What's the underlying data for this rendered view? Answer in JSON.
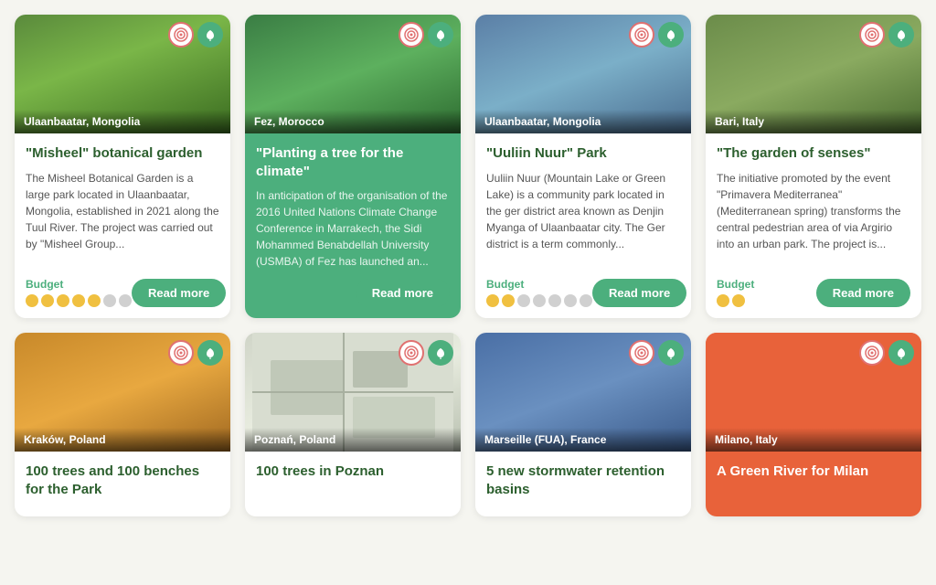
{
  "cards": [
    {
      "id": "misheel",
      "location": "Ulaanbaatar, Mongolia",
      "title": "\"Misheel\" botanical garden",
      "desc": "The Misheel Botanical Garden is a large park located in Ulaanbaatar, Mongolia, established in 2021 along the Tuul River. The project was carried out by \"Misheel Group...",
      "budget_label": "Budget",
      "budget_dots": [
        true,
        true,
        true,
        true,
        true,
        false,
        false
      ],
      "read_more": "Read more",
      "highlighted": false,
      "image_class": "forest"
    },
    {
      "id": "planting",
      "location": "Fez, Morocco",
      "title": "\"Planting a tree for the climate\"",
      "desc": "In anticipation of the organisation of the 2016 United Nations Climate Change Conference in Marrakech, the Sidi Mohammed Benabdellah University (USMBA) of Fez has launched an...",
      "budget_label": null,
      "budget_dots": [],
      "read_more": "Read more",
      "highlighted": true,
      "image_class": "trees-green"
    },
    {
      "id": "uuliin",
      "location": "Ulaanbaatar, Mongolia",
      "title": "\"Uuliin Nuur\" Park",
      "desc": "Uuliin Nuur (Mountain Lake or Green Lake) is a community park located in the ger district area known as Denjin Myanga of Ulaanbaatar city. The Ger district is a term commonly...",
      "budget_label": "Budget",
      "budget_dots": [
        true,
        true,
        false,
        false,
        false,
        false,
        false
      ],
      "read_more": "Read more",
      "highlighted": false,
      "image_class": "river"
    },
    {
      "id": "garden-senses",
      "location": "Bari, Italy",
      "title": "\"The garden of senses\"",
      "desc": "The initiative promoted by the event \"Primavera Mediterranea\" (Mediterranean spring) transforms the central pedestrian area of via Argirio into an urban park. The project is...",
      "budget_label": "Budget",
      "budget_dots": [
        true,
        true
      ],
      "read_more": "Read more",
      "highlighted": false,
      "image_class": "construction"
    },
    {
      "id": "100trees",
      "location": "Kraków, Poland",
      "title": "100 trees and 100 benches for the Park",
      "desc": "",
      "budget_label": null,
      "budget_dots": [],
      "read_more": null,
      "highlighted": false,
      "image_class": "autumn"
    },
    {
      "id": "poznan",
      "location": "Poznań, Poland",
      "title": "100 trees in Poznan",
      "desc": "",
      "budget_label": null,
      "budget_dots": [],
      "read_more": null,
      "highlighted": false,
      "image_class": "map"
    },
    {
      "id": "marseille",
      "location": "Marseille (FUA), France",
      "title": "5 new stormwater retention basins",
      "desc": "",
      "budget_label": null,
      "budget_dots": [],
      "read_more": null,
      "highlighted": false,
      "image_class": "city"
    },
    {
      "id": "milan",
      "location": "Milano, Italy",
      "title": "A Green River for Milan",
      "desc": "",
      "budget_label": null,
      "budget_dots": [],
      "read_more": null,
      "highlighted": false,
      "orange": true,
      "image_class": "orange-bg"
    }
  ],
  "icons": {
    "target": "◎",
    "leaf": "🌿"
  }
}
